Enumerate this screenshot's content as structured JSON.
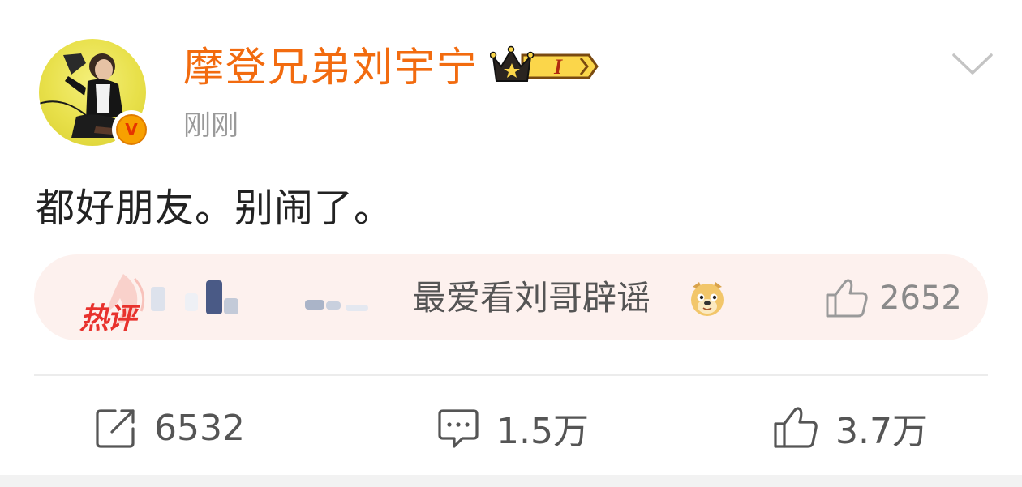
{
  "post": {
    "username": "摩登兄弟刘宇宁",
    "timestamp": "刚刚",
    "text": "都好朋友。别闹了。",
    "verified_badge": "V",
    "vip_level": "I"
  },
  "hot_comment": {
    "label": "热评",
    "text": "最爱看刘哥辟谣",
    "emoji": "doge",
    "likes": "2652"
  },
  "actions": {
    "repost_count": "6532",
    "comment_count": "1.5万",
    "like_count": "3.7万"
  },
  "colors": {
    "username": "#f26b0f",
    "hot_label": "#e8322d",
    "hot_bg": "#fdf1ee",
    "muted": "#999999"
  },
  "icons": {
    "menu": "chevron-down-icon",
    "repost": "repost-icon",
    "comment": "comment-icon",
    "like": "thumbs-up-icon"
  }
}
